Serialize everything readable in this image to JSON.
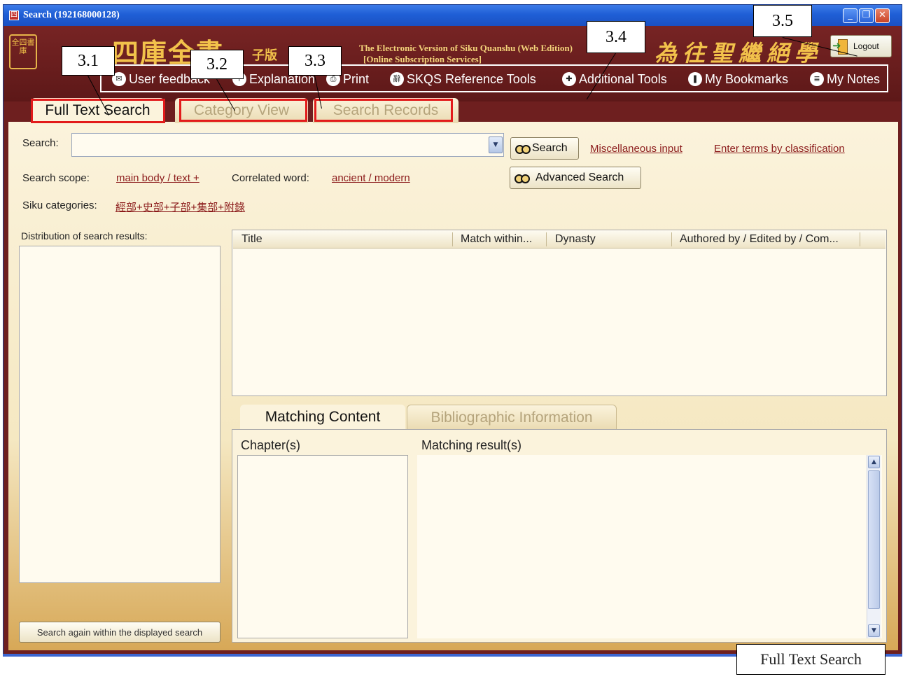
{
  "window": {
    "title": "Search (192168000128)",
    "controls": [
      "minimize",
      "restore",
      "close"
    ]
  },
  "banner": {
    "logo_text": "全四書庫",
    "title_cn": "四庫全書",
    "title_cn_small": "子版",
    "title_en_line1": "The Electronic Version of Siku Quanshu (Web Edition)",
    "title_en_line2": "[Online Subscription Services]",
    "motto_cn": "為往聖繼絕學",
    "logout_label": "Logout"
  },
  "toolbar": {
    "items": [
      {
        "label": "User feedback",
        "icon": "feedback-icon",
        "glyph": "✉"
      },
      {
        "label": "Explanation",
        "icon": "help-icon",
        "glyph": "?"
      },
      {
        "label": "Print",
        "icon": "print-icon",
        "glyph": "⎙"
      },
      {
        "label": "SKQS Reference Tools",
        "icon": "reference-icon",
        "glyph": "辭"
      },
      {
        "label": "Additional Tools",
        "icon": "tools-icon",
        "glyph": "✚"
      },
      {
        "label": "My Bookmarks",
        "icon": "bookmark-icon",
        "glyph": "❚"
      },
      {
        "label": "My Notes",
        "icon": "notes-icon",
        "glyph": "≣"
      }
    ]
  },
  "tabs": [
    {
      "label": "Full Text Search",
      "active": true
    },
    {
      "label": "Category View",
      "active": false
    },
    {
      "label": "Search Records",
      "active": false
    }
  ],
  "search": {
    "label": "Search:",
    "value": "",
    "button": "Search",
    "misc_link": "Miscellaneous input",
    "classify_link": "Enter terms by classification",
    "advanced_button": "Advanced Search",
    "scope_label": "Search scope:",
    "scope_value": "main body / text +",
    "correlated_label": "Correlated word:",
    "correlated_value": "ancient / modern",
    "categories_label": "Siku categories:",
    "categories_value": "經部+史部+子部+集部+附錄"
  },
  "distribution": {
    "label": "Distribution of search results:",
    "again_button": "Search again within the displayed search"
  },
  "results_table": {
    "columns": [
      "Title",
      "Match within...",
      "Dynasty",
      "Authored by / Edited by / Com..."
    ],
    "rows": []
  },
  "sub_tabs": [
    {
      "label": "Matching Content",
      "active": true
    },
    {
      "label": "Bibliographic Information",
      "active": false
    }
  ],
  "matching": {
    "chapters_label": "Chapter(s)",
    "results_label": "Matching result(s)"
  },
  "callouts": [
    "3.1",
    "3.2",
    "3.3",
    "3.4",
    "3.5"
  ],
  "caption": "Full Text Search",
  "colors": {
    "frame": "#6e1f1f",
    "panel": "#fbf3dc",
    "highlight": "#e21b1b",
    "link": "#8b1a1a",
    "titlebar": "#1f5fd6"
  }
}
